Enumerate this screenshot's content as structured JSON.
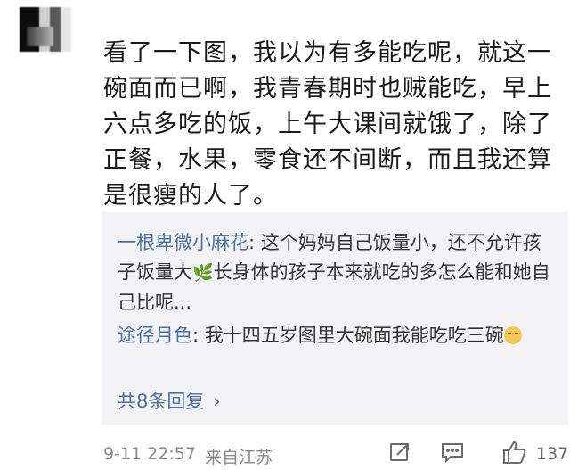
{
  "comment": {
    "text": "看了一下图，我以为有多能吃呢，就这一碗面而已啊，我青春期时也贼能吃，早上六点多吃的饭，上午大课间就饿了，除了正餐，水果，零食还不间断，而且我还算是很瘦的人了。"
  },
  "replies": [
    {
      "author": "一根卑微小麻花",
      "text_before_emoji": ": 这个妈妈自己饭量小，还不允许孩子饭量大",
      "emoji": "leaf",
      "text_after_emoji": "长身体的孩子本来就吃的多怎么能和她自己比呢..."
    },
    {
      "author": "途径月色",
      "text_before_emoji": ": 我十四五岁图里大碗面我能吃吃三碗",
      "emoji": "smile-face"
    }
  ],
  "more_replies_label": "共8条回复",
  "footer": {
    "timestamp": "9-11 22:57",
    "location": "来自江苏",
    "like_count": "137"
  }
}
